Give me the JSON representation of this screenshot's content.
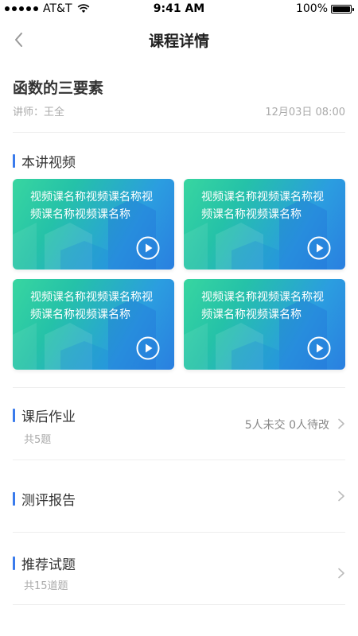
{
  "status_bar": {
    "carrier": "AT&T",
    "time": "9:41 AM",
    "battery": "100%"
  },
  "nav": {
    "title": "课程详情",
    "back_icon": "chevron-left-icon"
  },
  "course": {
    "title": "函数的三要素",
    "teacher": "讲师：王全",
    "datetime": "12月03日 08:00"
  },
  "videos": {
    "section_title": "本讲视频",
    "items": [
      {
        "title": "视频课名称视频课名称视频课名称视频课名称"
      },
      {
        "title": "视频课名称视频课名称视频课名称视频课名称"
      },
      {
        "title": "视频课名称视频课名称视频课名称视频课名称"
      },
      {
        "title": "视频课名称视频课名称视频课名称视频课名称"
      }
    ]
  },
  "homework": {
    "title": "课后作业",
    "count": "共5题",
    "status": "5人未交 0人待改"
  },
  "report": {
    "title": "测评报告"
  },
  "recommend": {
    "title": "推荐试题",
    "count": "共15道题"
  },
  "colors": {
    "accent": "#3a7bec",
    "card_start": "#38d6a0",
    "card_end": "#2a7fe0"
  }
}
